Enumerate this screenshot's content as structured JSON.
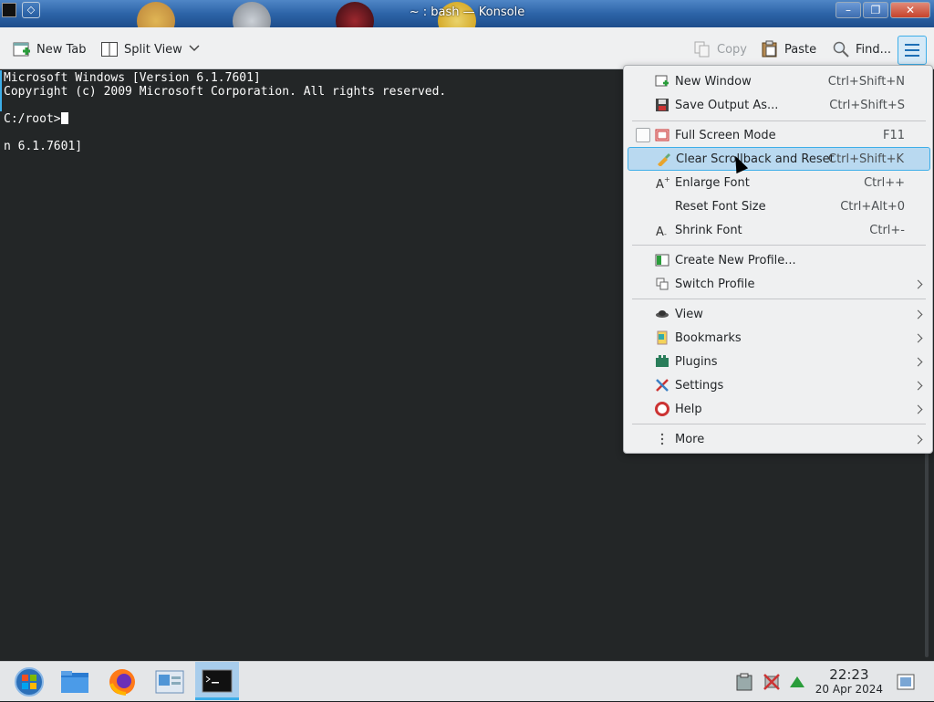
{
  "window": {
    "title": "~ : bash — Konsole",
    "buttons": {
      "minimize": "–",
      "maximize": "❐",
      "close": "✕"
    },
    "pin_glyph": "◇"
  },
  "toolbar": {
    "new_tab": "New Tab",
    "split_view": "Split View",
    "copy": "Copy",
    "paste": "Paste",
    "find": "Find..."
  },
  "terminal": {
    "lines": [
      "Microsoft Windows [Version 6.1.7601]",
      "Copyright (c) 2009 Microsoft Corporation. All rights reserved.",
      "",
      "C:/root>",
      "",
      "n 6.1.7601]"
    ]
  },
  "menu": {
    "items": [
      {
        "label": "New Window",
        "shortcut": "Ctrl+Shift+N",
        "icon": "new-window-icon"
      },
      {
        "label": "Save Output As...",
        "shortcut": "Ctrl+Shift+S",
        "icon": "save-icon"
      },
      {
        "label": "Full Screen Mode",
        "shortcut": "F11",
        "icon": "fullscreen-icon"
      },
      {
        "label": "Clear Scrollback and Reset",
        "shortcut": "Ctrl+Shift+K",
        "icon": "clear-icon"
      },
      {
        "label": "Enlarge Font",
        "shortcut": "Ctrl++",
        "icon": "enlarge-font-icon"
      },
      {
        "label": "Reset Font Size",
        "shortcut": "Ctrl+Alt+0",
        "icon": ""
      },
      {
        "label": "Shrink Font",
        "shortcut": "Ctrl+-",
        "icon": "shrink-font-icon"
      },
      {
        "label": "Create New Profile...",
        "shortcut": "",
        "icon": "new-profile-icon"
      },
      {
        "label": "Switch Profile",
        "shortcut": "",
        "icon": "switch-profile-icon"
      },
      {
        "label": "View",
        "shortcut": "",
        "icon": "view-icon"
      },
      {
        "label": "Bookmarks",
        "shortcut": "",
        "icon": "bookmarks-icon"
      },
      {
        "label": "Plugins",
        "shortcut": "",
        "icon": "plugins-icon"
      },
      {
        "label": "Settings",
        "shortcut": "",
        "icon": "settings-icon"
      },
      {
        "label": "Help",
        "shortcut": "",
        "icon": "help-icon"
      },
      {
        "label": "More",
        "shortcut": "",
        "icon": "more-icon"
      }
    ]
  },
  "taskbar": {
    "time": "22:23",
    "date": "20 Apr 2024",
    "apps": [
      "start-icon",
      "file-manager-icon",
      "firefox-icon",
      "control-panel-icon",
      "konsole-icon"
    ]
  },
  "colors": {
    "accent": "#3daee9",
    "terminal_bg": "#232627",
    "menu_bg": "#eff0f1",
    "highlight": "#b9d9f0"
  }
}
